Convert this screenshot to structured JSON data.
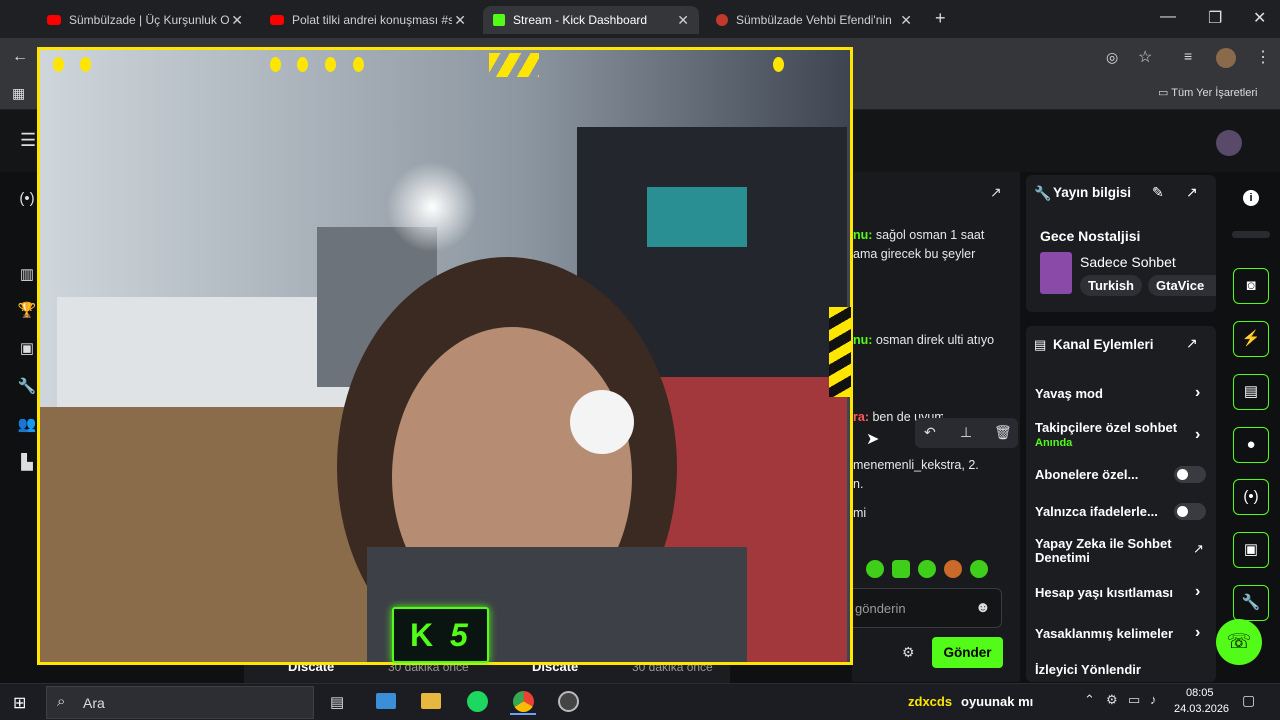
{
  "browser": {
    "tabs": [
      {
        "title": "Sümbülzade | Üç Kurşunluk Op",
        "icon": "youtube-icon",
        "active": false
      },
      {
        "title": "Polat tilki andrei konuşması #sl",
        "icon": "youtube-icon",
        "active": false
      },
      {
        "title": "Stream - Kick Dashboard",
        "icon": "kick-icon",
        "active": true
      },
      {
        "title": "Sümbülzade Vehbi Efendi'nin P",
        "icon": "site-icon",
        "active": false
      }
    ],
    "new_tab": "+",
    "bookmarks_label": "Tüm Yer İşaretleri"
  },
  "chat": {
    "messages": [
      {
        "user": "nu:",
        "text": "sağol osman 1 saat",
        "cont": "ama girecek bu şeyler"
      },
      {
        "user": "nu:",
        "text": "osman direk ulti atıyo"
      },
      {
        "user": "ra:",
        "text": "ben de uyumaya"
      },
      {
        "user": "",
        "text": "menemenli_kekstra, 2.",
        "cont": "n."
      },
      {
        "user": "",
        "text": "mi"
      }
    ],
    "input_placeholder": "gönderin",
    "send_label": "Gönder"
  },
  "stream_info": {
    "title": "Yayın bilgisi",
    "stream_title": "Gece Nostaljisi",
    "category": "Sadece Sohbet",
    "tags": [
      "Turkish",
      "GtaVice"
    ]
  },
  "channel_actions": {
    "title": "Kanal Eylemleri",
    "items": [
      {
        "label": "Yavaş mod",
        "control": "chevron"
      },
      {
        "label": "Takipçilere özel sohbet",
        "sub": "Anında",
        "control": "chevron"
      },
      {
        "label": "Abonelere özel...",
        "control": "toggle"
      },
      {
        "label": "Yalnızca ifadelerle...",
        "control": "toggle"
      },
      {
        "label": "Yapay Zeka ile Sohbet Denetimi",
        "control": "external"
      },
      {
        "label": "Hesap yaşı kısıtlaması",
        "control": "chevron"
      },
      {
        "label": "Yasaklanmış kelimeler",
        "control": "chevron"
      },
      {
        "label": "İzleyici Yönlendir",
        "control": "none"
      }
    ]
  },
  "overlay": {
    "badge_letter": "K",
    "badge_number": "5"
  },
  "behind": {
    "left_card": "Discate",
    "left_time": "30 dakika önce",
    "right_card": "Discate",
    "right_time": "30 dakika önce"
  },
  "taskbar": {
    "search_placeholder": "Ara",
    "now_playing_user": "zdxcds",
    "now_playing_text": "oyuunak mı",
    "time": "08:05",
    "date": "24.03.2026"
  },
  "colors": {
    "accent": "#53fc18",
    "overlay_yellow": "#ffe600"
  }
}
